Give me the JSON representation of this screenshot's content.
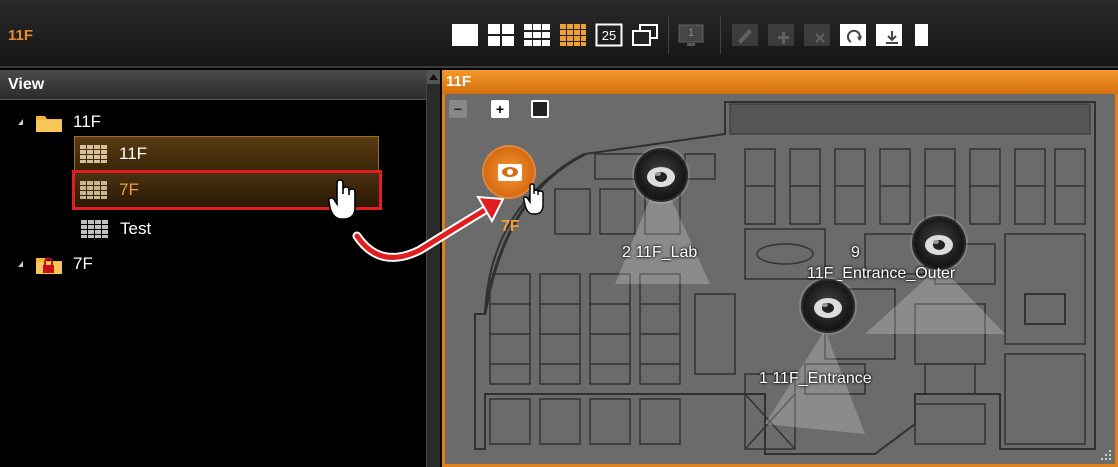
{
  "window": {
    "title": "11F"
  },
  "toolbar": {
    "items": [
      {
        "name": "layout-1x1-icon"
      },
      {
        "name": "layout-2x2-icon"
      },
      {
        "name": "layout-3x3-icon"
      },
      {
        "name": "layout-4x4-icon"
      },
      {
        "name": "layout-25-icon",
        "label": "25"
      },
      {
        "name": "layout-custom-icon"
      },
      {
        "name": "monitor-icon",
        "label": "1"
      },
      {
        "name": "edit-icon"
      },
      {
        "name": "add-icon"
      },
      {
        "name": "delete-icon"
      },
      {
        "name": "refresh-icon"
      },
      {
        "name": "download-icon"
      },
      {
        "name": "more-icon"
      }
    ]
  },
  "tree": {
    "header": "View",
    "items": [
      {
        "label": "11F",
        "type": "folder",
        "level": 0
      },
      {
        "label": "11F",
        "type": "view",
        "level": 1,
        "state": "selected"
      },
      {
        "label": "7F",
        "type": "view",
        "level": 1,
        "state": "highlighted"
      },
      {
        "label": "Test",
        "type": "view",
        "level": 1
      },
      {
        "label": "7F",
        "type": "locked-folder",
        "level": 0
      }
    ]
  },
  "map": {
    "title": "11F",
    "zoom_controls": {
      "minus": "−",
      "plus": "+",
      "fit": "□"
    },
    "view_link": {
      "label": "7F"
    },
    "cameras": [
      {
        "id": "cam-2",
        "label": "2 11F_Lab"
      },
      {
        "id": "cam-9",
        "label_line1": "9",
        "label_line2": "11F_Entrance_Outer"
      },
      {
        "id": "cam-1",
        "label": "1 11F_Entrance"
      }
    ]
  },
  "colors": {
    "accent": "#e0801a",
    "highlight": "#e21d1d",
    "title_text": "#e88a2c"
  }
}
